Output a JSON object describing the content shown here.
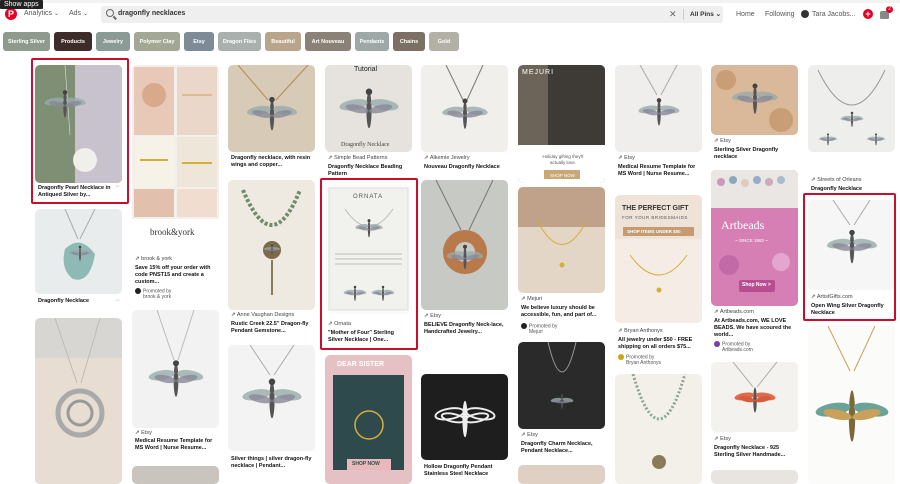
{
  "header": {
    "tooltip": "Show apps",
    "analytics_label": "Analytics",
    "ads_label": "Ads",
    "search_query": "dragonfly necklaces",
    "filter_label": "All Pins",
    "home_label": "Home",
    "following_label": "Following",
    "user_name": "Tara Jacobs...",
    "notification_count": "2",
    "colors": {
      "brand": "#e60023"
    }
  },
  "guides": [
    {
      "label": "Sterling Silver",
      "color": "#8f9a8d"
    },
    {
      "label": "Products",
      "color": "#3d2c2a"
    },
    {
      "label": "Jewelry",
      "color": "#8a9a95"
    },
    {
      "label": "Polymer Clay",
      "color": "#a3a894"
    },
    {
      "label": "Etsy",
      "color": "#7d8a98"
    },
    {
      "label": "Dragon Flies",
      "color": "#a9b0ae"
    },
    {
      "label": "Beautiful",
      "color": "#b9a48c"
    },
    {
      "label": "Art Nouveau",
      "color": "#8a8276"
    },
    {
      "label": "Pendants",
      "color": "#9ea8a6"
    },
    {
      "label": "Chains",
      "color": "#7c6f64"
    },
    {
      "label": "Gold",
      "color": "#b3b0a6"
    }
  ],
  "pins": {
    "p1": {
      "title": "Dragonfly Pearl Necklace in Antiqued Silver by..."
    },
    "p2": {
      "title": "Dragonfly Necklace"
    },
    "p3": {
      "source": "brook & york",
      "title": "Save 15% off your order with code PNST15 and create a custom...",
      "promoted": "Promoted by",
      "promoter": "brook & york",
      "ad_text": "brook&york"
    },
    "p4": {
      "source": "Etsy",
      "title": "Medical Resume Template for MS Word | Nurse Resume..."
    },
    "p5": {
      "title": "Dragonfly necklace, with resin wings and copper..."
    },
    "p6": {
      "source": "Anne Vaughan Designs",
      "title": "Rustic Creek 22.5\" Dragon-fly Pendant Gemstone..."
    },
    "p7": {
      "title": "Silver things | silver dragon-fly necklace | Pendant..."
    },
    "p8": {
      "source": "Simple Bead Patterns",
      "title": "Dragonfly Necklace Beading Pattern",
      "image_text": "Tutorial",
      "image_caption": "Dragonfly Necklace"
    },
    "p9": {
      "source": "Ornata",
      "title": "\"Mother of Four\" Sterling Silver Necklace | One...",
      "image_text": "ORNATA"
    },
    "p10": {
      "image_text1": "DEAR SISTER",
      "image_text2": "SHOP NOW"
    },
    "p11": {
      "source": "Alkemie Jewelry",
      "title": "Nouveau Dragonfly Necklace"
    },
    "p12": {
      "source": "Etsy",
      "title": "BELIEVE Dragonfly Neck-lace, Handcrafted Jewelry..."
    },
    "p13": {
      "title": "Hollow Dragonfly Pendant Stainless Steel Necklace"
    },
    "p14": {
      "image_text": "MEJURI",
      "image_sub": "Holiday gifting they'll actually love.",
      "image_btn": "SHOP NOW"
    },
    "p15": {
      "source": "Mejuri",
      "title": "We believe luxury should be accessible, fun, and part of...",
      "promoted": "Promoted by",
      "promoter": "Mejuri"
    },
    "p16": {
      "source": "Etsy",
      "title": "Dragonfly Charm Necklace, Pendant Necklace..."
    },
    "p17": {
      "source": "Etsy",
      "title": "Medical Resume Template for MS Word | Nurse Resume..."
    },
    "p18": {
      "source": "Bryan Anthonys",
      "title": "All jewelry under $50 - FREE shipping on all orders $75...",
      "promoted": "Promoted by",
      "promoter": "Bryan Anthonys",
      "image_text1": "THE PERFECT GIFT",
      "image_text2": "FOR YOUR BRIDESMAIDS",
      "image_btn": "SHOP ITEMS UNDER $50"
    },
    "p19": {
      "source": "Etsy",
      "title": "Sterling Silver Dragonfly necklace"
    },
    "p20": {
      "source": "Artbeads.com",
      "title": "At Artbeads.com, WE LOVE BEADS. We have scoured the world...",
      "promoted": "Promoted by",
      "promoter": "Artbeads.com",
      "image_text1": "Artbeads",
      "image_text2": "~ SINCE 1993 ~",
      "image_btn": "Shop Now >"
    },
    "p21": {
      "source": "Etsy",
      "title": "Dragonfly Necklace - 925 Sterling Silver Handmade..."
    },
    "p22": {
      "source": "Streets of Orleans",
      "title": "Dragonfly Necklace"
    },
    "p23": {
      "source": "ArtistGifts.com",
      "title": "Open Wing Silver Dragonfly Necklace"
    }
  },
  "icons": [
    "pinterest-logo",
    "search-icon",
    "clear-icon",
    "chevron-down-icon",
    "plus-icon",
    "bell-icon",
    "dragonfly-icon",
    "more-icon"
  ]
}
